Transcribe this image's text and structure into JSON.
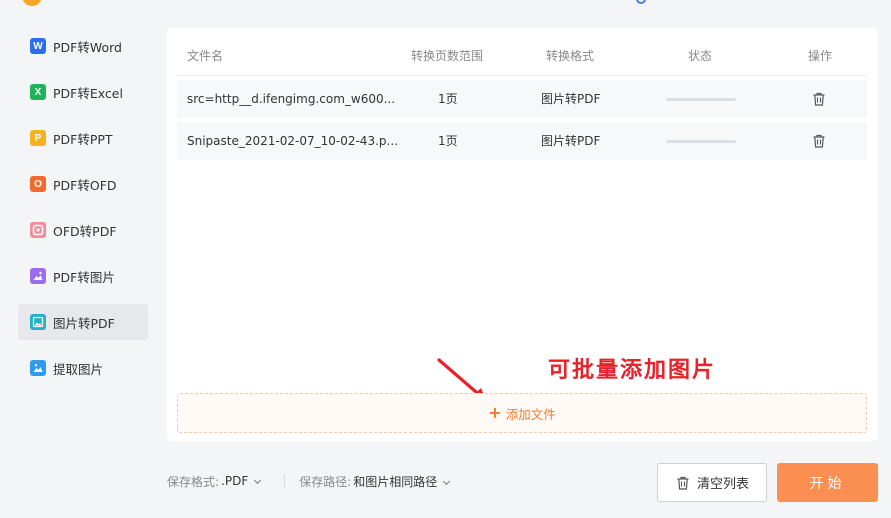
{
  "sidebar": {
    "items": [
      {
        "label": "PDF转Word",
        "icon": "word-icon",
        "glyph": "W",
        "color": "#2b6ff0",
        "active": false
      },
      {
        "label": "PDF转Excel",
        "icon": "excel-icon",
        "glyph": "X",
        "color": "#1fb45a",
        "active": false
      },
      {
        "label": "PDF转PPT",
        "icon": "ppt-icon",
        "glyph": "P",
        "color": "#f7b21f",
        "active": false
      },
      {
        "label": "PDF转OFD",
        "icon": "ofd-icon",
        "glyph": "O",
        "color": "#f26a2e",
        "active": false
      },
      {
        "label": "OFD转PDF",
        "icon": "ofd-to-pdf-icon",
        "glyph": "",
        "color": "#f58b9a",
        "active": false
      },
      {
        "label": "PDF转图片",
        "icon": "pdf-to-image-icon",
        "glyph": "",
        "color": "#9a6cf0",
        "active": false
      },
      {
        "label": "图片转PDF",
        "icon": "image-to-pdf-icon",
        "glyph": "",
        "color": "#1fb3c9",
        "active": true
      },
      {
        "label": "提取图片",
        "icon": "extract-image-icon",
        "glyph": "",
        "color": "#2e9bf0",
        "active": false
      }
    ]
  },
  "table": {
    "headers": {
      "name": "文件名",
      "range": "转换页数范围",
      "format": "转换格式",
      "status": "状态",
      "action": "操作"
    },
    "rows": [
      {
        "name": "src=http__d.ifengimg.com_w600...",
        "range": "1页",
        "format": "图片转PDF",
        "progress": 0
      },
      {
        "name": "Snipaste_2021-02-07_10-02-43.p...",
        "range": "1页",
        "format": "图片转PDF",
        "progress": 0
      }
    ]
  },
  "annotation": "可批量添加图片",
  "add_file": {
    "label": "添加文件"
  },
  "bottom": {
    "format_label": "保存格式:",
    "format_value": ".PDF",
    "path_label": "保存路径:",
    "path_value": "和图片相同路径"
  },
  "buttons": {
    "clear": "清空列表",
    "start": "开始"
  },
  "colors": {
    "accent": "#fb8f51",
    "annotation": "#e8212b"
  }
}
